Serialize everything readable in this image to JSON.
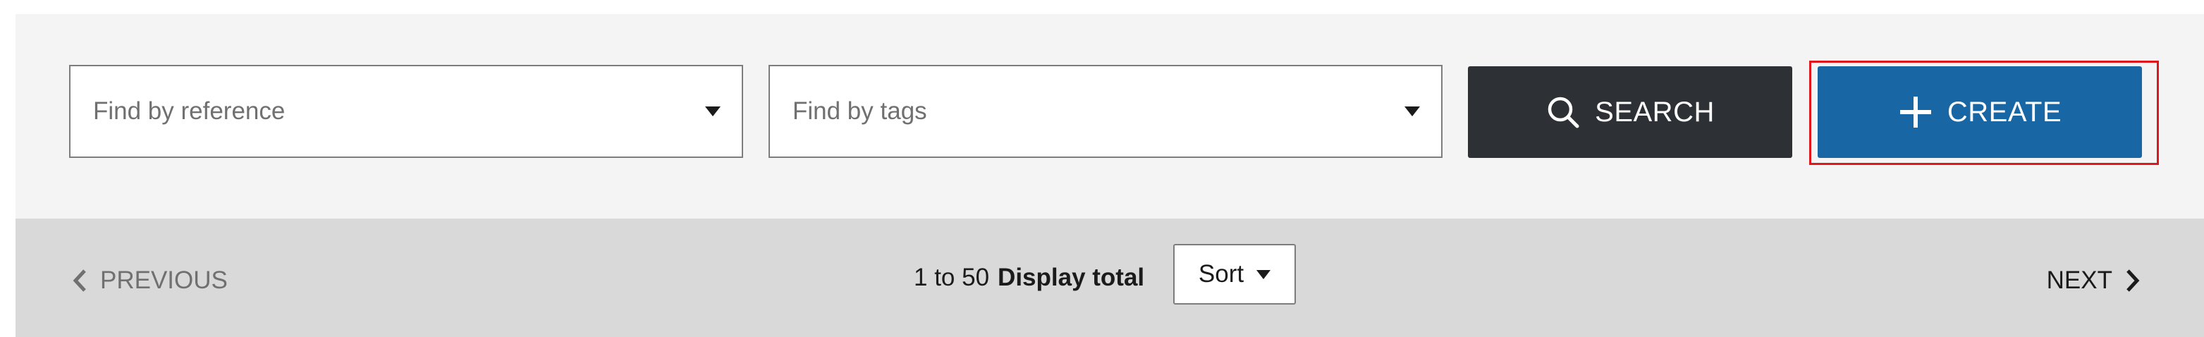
{
  "search": {
    "reference_placeholder": "Find by reference",
    "tags_placeholder": "Find by tags",
    "search_label": "SEARCH",
    "create_label": "CREATE",
    "search_icon": "search-icon",
    "create_icon": "plus-icon"
  },
  "pagination": {
    "previous_label": "PREVIOUS",
    "next_label": "NEXT",
    "range_text": "1 to 50",
    "total_label": "Display total",
    "sort_label": "Sort"
  },
  "colors": {
    "search_button": "#2d3136",
    "create_button": "#1866a3",
    "highlight_outline": "#e1161d",
    "panel_background": "#f4f4f4",
    "pager_background": "#d9d9d9"
  }
}
